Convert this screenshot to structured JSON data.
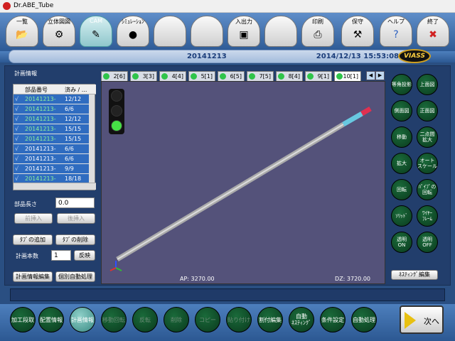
{
  "window": {
    "title": "Dr.ABE_Tube"
  },
  "toolbar": {
    "buttons": [
      {
        "label": "一覧",
        "icon": "folder-icon"
      },
      {
        "label": "立体図図",
        "icon": "pipe-icon"
      },
      {
        "label": "CAM",
        "icon": "cam-icon",
        "active": true
      },
      {
        "label": "ｼﾐｭﾚｰｼｮﾝ",
        "icon": "simulation-icon"
      },
      {
        "label": "",
        "icon": ""
      },
      {
        "label": "",
        "icon": ""
      },
      {
        "label": "入出力",
        "icon": "io-icon"
      },
      {
        "label": "",
        "icon": ""
      },
      {
        "label": "印刷",
        "icon": "printer-icon"
      },
      {
        "label": "保守",
        "icon": "maintenance-icon"
      },
      {
        "label": "ヘルプ",
        "icon": "help-icon"
      },
      {
        "label": "終了",
        "icon": "close-icon"
      }
    ]
  },
  "header": {
    "plan_name": "20141213",
    "datetime": "2014/12/13 15:53:08",
    "logo": "VIASS"
  },
  "plan_info": {
    "title": "計画情報",
    "columns": [
      "部品番号",
      "済み / ..."
    ],
    "rows": [
      {
        "part": "20141213-",
        "done": "12/12",
        "color": "green"
      },
      {
        "part": "20141213-",
        "done": "6/6",
        "color": "green"
      },
      {
        "part": "20141213-",
        "done": "12/12",
        "color": "green"
      },
      {
        "part": "20141213-",
        "done": "15/15",
        "color": "green"
      },
      {
        "part": "20141213-",
        "done": "15/15",
        "color": "green"
      },
      {
        "part": "20141213-",
        "done": "6/6",
        "color": "white"
      },
      {
        "part": "20141213-",
        "done": "6/6",
        "color": "white"
      },
      {
        "part": "20141213-",
        "done": "9/9",
        "color": "white"
      },
      {
        "part": "20141213-",
        "done": "18/18",
        "color": "green"
      }
    ],
    "part_length_label": "部品長さ",
    "part_length_value": "0.0",
    "insert_before": "前挿入",
    "insert_after": "後挿入",
    "add_tab": "ﾀﾌﾞの追加",
    "delete_tab": "ﾀﾌﾞの削除",
    "plan_count_label": "計画本数",
    "plan_count_value": "1",
    "apply": "反映",
    "edit_plan": "計画情報編集",
    "auto_process": "個別自動処理"
  },
  "tabs": [
    {
      "label": "2[6]"
    },
    {
      "label": "3[3]"
    },
    {
      "label": "4[4]"
    },
    {
      "label": "5[1]"
    },
    {
      "label": "6[5]"
    },
    {
      "label": "7[5]"
    },
    {
      "label": "8[4]"
    },
    {
      "label": "9[1]"
    },
    {
      "label": "10[1]",
      "active": true
    }
  ],
  "viewport": {
    "ap": "AP:  3270.00",
    "dz": "DZ:  3720.00"
  },
  "view_buttons": [
    {
      "label": "等角投影"
    },
    {
      "label": "上面図"
    },
    {
      "label": "側面図"
    },
    {
      "label": "正面図"
    },
    {
      "label": "移動"
    },
    {
      "label": "二点間\n拡大"
    },
    {
      "label": "拡大"
    },
    {
      "label": "オート\nスケール"
    },
    {
      "label": "回転"
    },
    {
      "label": "ﾊﾟｲﾌﾟの\n回転"
    },
    {
      "label": "ｿﾘｯﾄﾞ"
    },
    {
      "label": "ﾜｲﾔｰ\nﾌﾚｰﾑ"
    },
    {
      "label": "透明\nON"
    },
    {
      "label": "透明\nOFF"
    }
  ],
  "nesting_edit": "ﾈｽﾃｨﾝｸﾞ編集",
  "bottom_buttons": [
    {
      "label": "加工段取",
      "dim": false
    },
    {
      "label": "配置情報",
      "dim": false
    },
    {
      "label": "計画情報",
      "dim": false,
      "active": true
    },
    {
      "label": "移動回転",
      "dim": true
    },
    {
      "label": "反転",
      "dim": true
    },
    {
      "label": "削除",
      "dim": true
    },
    {
      "label": "コピー",
      "dim": true
    },
    {
      "label": "貼り付け",
      "dim": true
    },
    {
      "label": "割付編集",
      "dim": false
    },
    {
      "label": "自動\nﾈｽﾃｨﾝｸﾞ",
      "dim": false
    },
    {
      "label": "条件設定",
      "dim": false
    },
    {
      "label": "自動処理",
      "dim": false
    }
  ],
  "next": "次へ"
}
